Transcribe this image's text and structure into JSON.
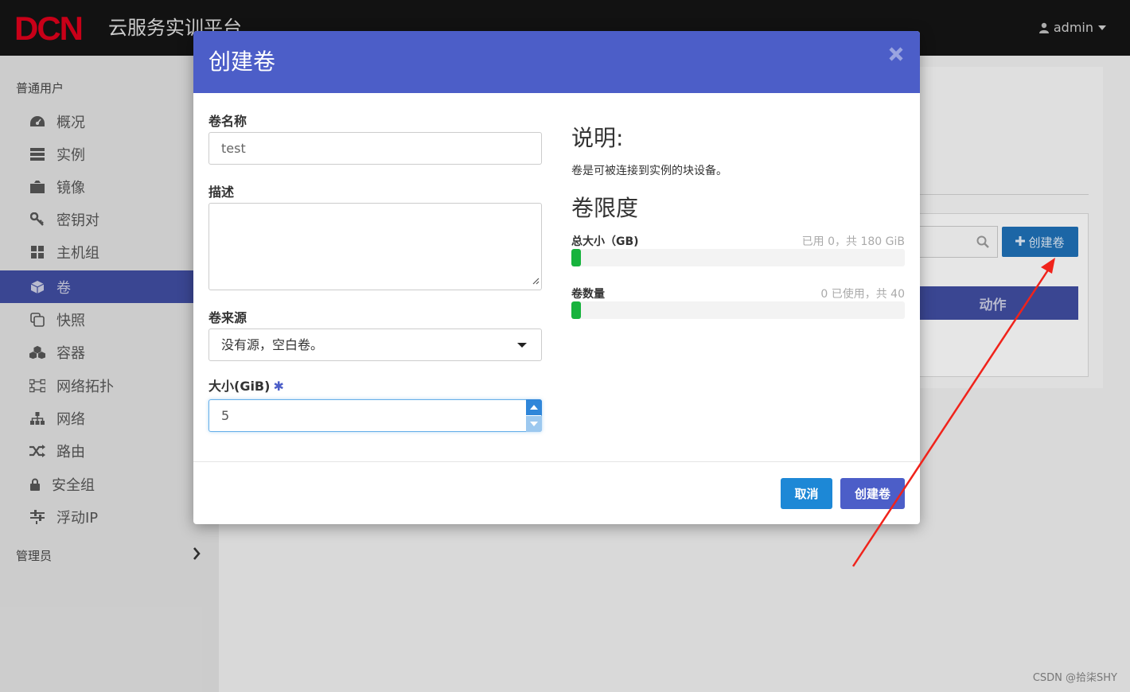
{
  "header": {
    "logo_text": "DCN",
    "platform_title": "云服务实训平台",
    "user_name": "admin",
    "brand_color": "#d9001b"
  },
  "sidebar": {
    "section_user": "普通用户",
    "items": [
      {
        "label": "概况",
        "icon": "dashboard-icon"
      },
      {
        "label": "实例",
        "icon": "server-icon"
      },
      {
        "label": "镜像",
        "icon": "image-icon"
      },
      {
        "label": "密钥对",
        "icon": "key-icon"
      },
      {
        "label": "主机组",
        "icon": "grid-icon"
      },
      {
        "label": "卷",
        "icon": "cube-icon",
        "active": true
      },
      {
        "label": "快照",
        "icon": "snapshot-icon"
      },
      {
        "label": "容器",
        "icon": "cubes-icon"
      },
      {
        "label": "网络拓扑",
        "icon": "topology-icon"
      },
      {
        "label": "网络",
        "icon": "sitemap-icon"
      },
      {
        "label": "路由",
        "icon": "random-icon"
      },
      {
        "label": "安全组",
        "icon": "lock-icon"
      },
      {
        "label": "浮动IP",
        "icon": "sliders-icon"
      }
    ],
    "section_admin": "管理员",
    "active_color": "#3f4d9f"
  },
  "background_page": {
    "create_button_label": "创建卷",
    "table_header_actions": "动作"
  },
  "modal": {
    "title": "创建卷",
    "header_color": "#4c5ec8",
    "form": {
      "name_label": "卷名称",
      "name_value": "test",
      "description_label": "描述",
      "description_value": "",
      "source_label": "卷来源",
      "source_selected": "没有源，空白卷。",
      "size_label": "大小(GiB)",
      "size_required_mark": "✱",
      "size_value": "5"
    },
    "help": {
      "title": "说明:",
      "text": "卷是可被连接到实例的块设备。",
      "limits_title": "卷限度",
      "quota_size_label": "总大小（GB)",
      "quota_size_value": "已用 0，共 180 GiB",
      "quota_size_fraction": 0.0,
      "quota_count_label": "卷数量",
      "quota_count_value": "0 已使用，共 40",
      "quota_count_fraction": 0.0
    },
    "buttons": {
      "cancel": "取消",
      "submit": "创建卷"
    }
  },
  "watermark": "CSDN @拾柒SHY"
}
